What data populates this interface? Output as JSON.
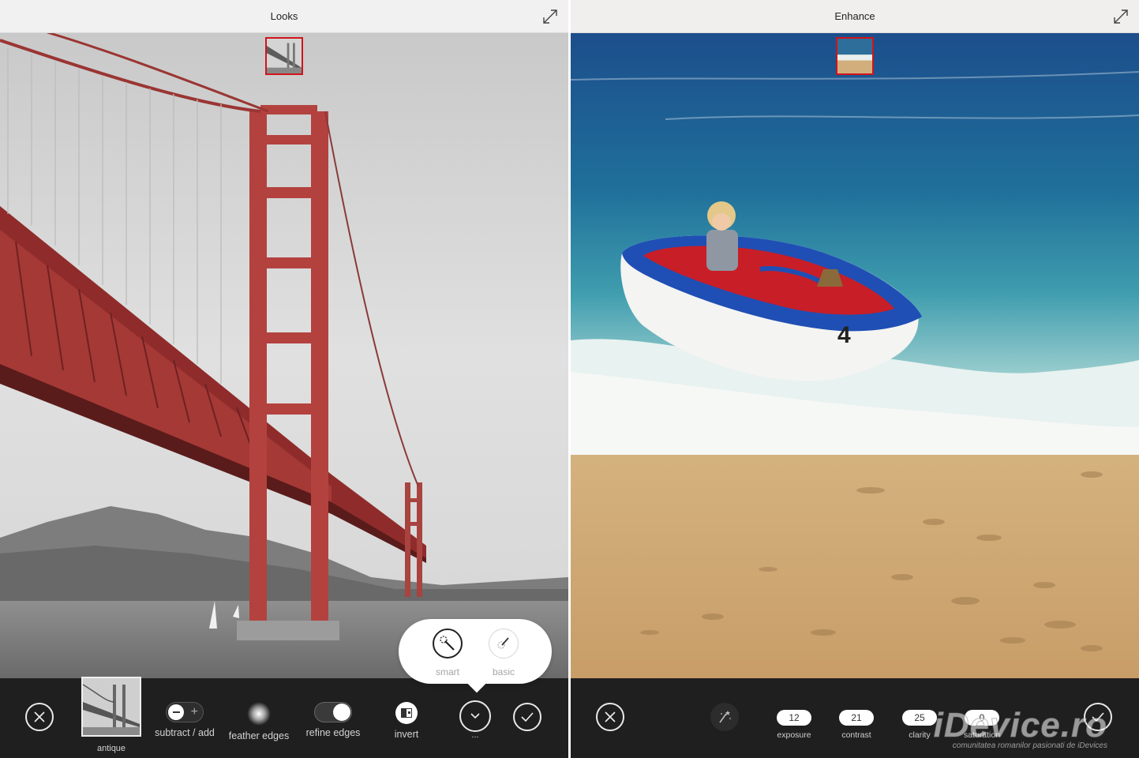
{
  "left": {
    "title": "Looks",
    "toolbar": {
      "look_thumb_label": "antique",
      "subtract_add_label": "subtract / add",
      "feather_label": "feather edges",
      "refine_label": "refine edges",
      "invert_label": "invert",
      "more_label": "..."
    },
    "popover": {
      "smart_label": "smart",
      "basic_label": "basic"
    },
    "refine_toggle_on": true
  },
  "right": {
    "title": "Enhance",
    "boat_number": "4",
    "sliders": [
      {
        "value": "12",
        "label": "exposure"
      },
      {
        "value": "21",
        "label": "contrast"
      },
      {
        "value": "25",
        "label": "clarity"
      },
      {
        "value": "0",
        "label": "saturation"
      }
    ]
  },
  "watermark": {
    "brand": "iDevice.ro",
    "tagline": "comunitatea romanilor pasionati de iDevices"
  },
  "colors": {
    "selection_red": "#d0141b",
    "toolbar_bg": "#1f1f1f",
    "bridge_red": "#b3423f"
  }
}
